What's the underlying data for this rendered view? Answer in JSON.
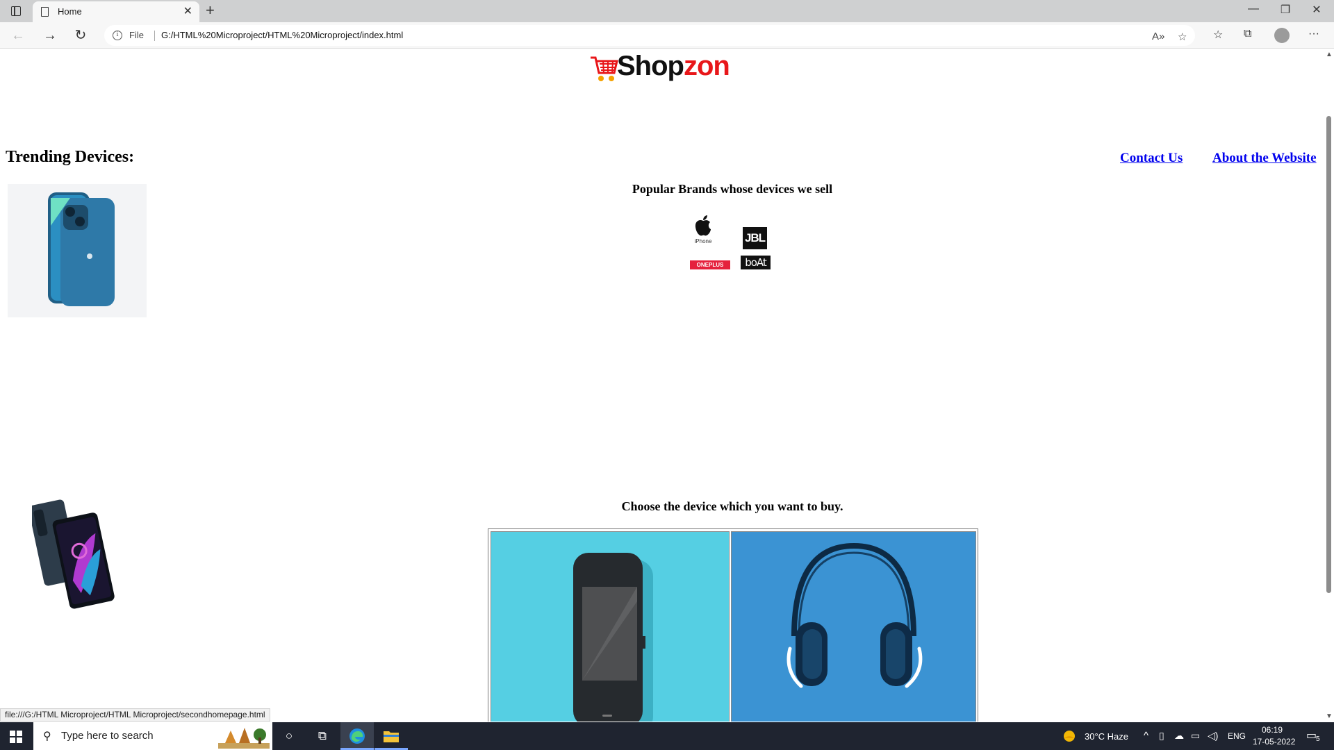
{
  "browser": {
    "tab_title": "Home",
    "address_prefix": "File",
    "url": "G:/HTML%20Microproject/HTML%20Microproject/index.html",
    "status_url": "file:///G:/HTML Microproject/HTML Microproject/secondhomepage.html",
    "icons": [
      "tab-actions-icon",
      "document-icon",
      "close-icon",
      "new-tab-icon",
      "back-icon",
      "forward-icon",
      "refresh-icon",
      "info-icon",
      "read-aloud-icon",
      "add-favorite-icon",
      "favorites-icon",
      "collections-icon",
      "profile-icon",
      "more-icon",
      "minimize-icon",
      "restore-icon",
      "close-window-icon"
    ]
  },
  "page": {
    "logo": {
      "part1": "Shop",
      "part2": "zon"
    },
    "trending_heading": "Trending Devices:",
    "nav": {
      "contact": "Contact Us",
      "about": "About the Website"
    },
    "brands_heading": "Popular Brands whose devices we sell",
    "brands": {
      "apple_caption": "iPhone",
      "jbl": "JBL",
      "oneplus": "ONEPLUS",
      "boat": "boAt"
    },
    "choose_heading": "Choose the device which you want to buy."
  },
  "taskbar": {
    "search_placeholder": "Type here to search",
    "weather": "30°C  Haze",
    "language": "ENG",
    "time": "06:19",
    "date": "17-05-2022",
    "notifications": "5"
  },
  "colors": {
    "brand_red": "#e8171a",
    "link": "#0000ee",
    "phone_bg": "#55cfe3",
    "headphone_bg": "#3b93d3"
  }
}
